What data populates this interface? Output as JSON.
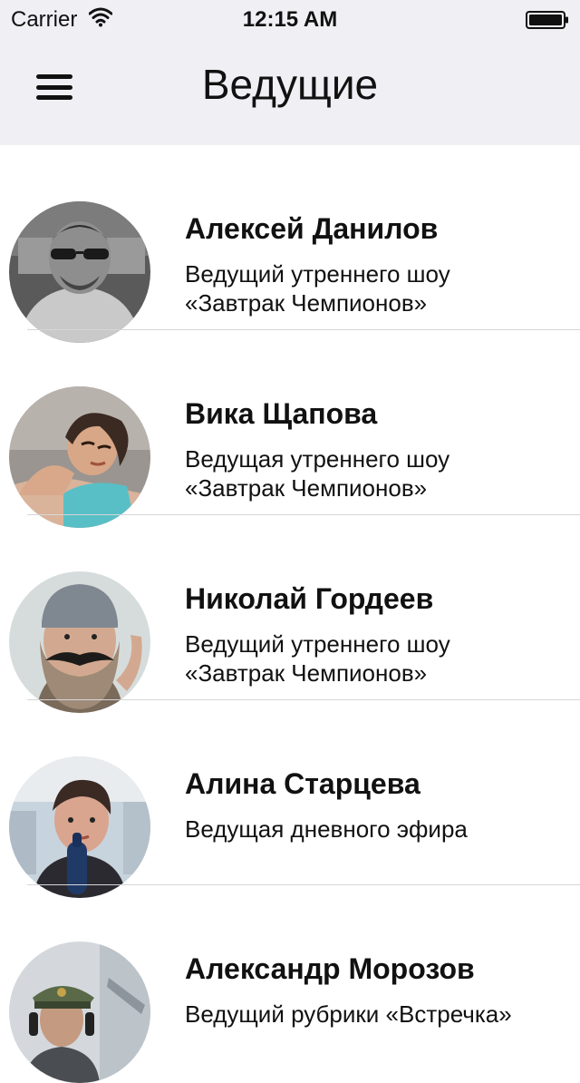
{
  "status_bar": {
    "carrier": "Carrier",
    "time": "12:15 AM"
  },
  "nav": {
    "title": "Ведущие",
    "menu_icon": "hamburger-icon"
  },
  "hosts": [
    {
      "name": "Алексей Данилов",
      "role": "Ведущий утреннего шоу\n«Завтрак Чемпионов»"
    },
    {
      "name": "Вика Щапова",
      "role": "Ведущая утреннего шоу\n«Завтрак Чемпионов»"
    },
    {
      "name": "Николай Гордеев",
      "role": "Ведущий утреннего шоу\n«Завтрак Чемпионов»"
    },
    {
      "name": "Алина Старцева",
      "role": "Ведущая дневного эфира"
    },
    {
      "name": "Александр Морозов",
      "role": "Ведущий рубрики «Встречка»"
    }
  ],
  "colors": {
    "bar_background": "#efeff4",
    "separator": "#d6d6d9",
    "text": "#111111"
  }
}
